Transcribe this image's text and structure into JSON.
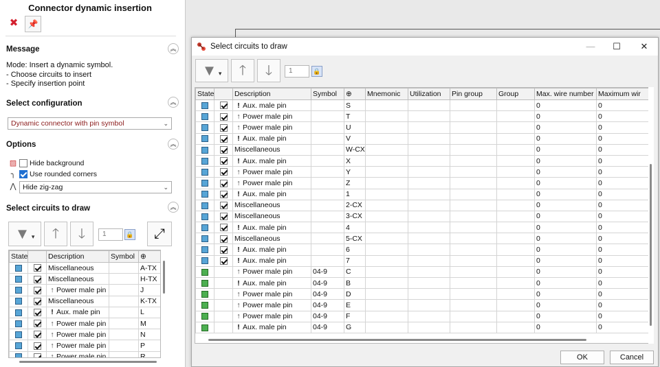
{
  "left_panel": {
    "title": "Connector dynamic insertion",
    "message": {
      "heading": "Message",
      "lines": [
        "Mode: Insert a dynamic symbol.",
        "- Choose circuits to insert",
        "- Specify insertion point"
      ]
    },
    "configuration": {
      "heading": "Select configuration",
      "value": "Dynamic connector with pin symbol"
    },
    "options": {
      "heading": "Options",
      "hide_background": "Hide background",
      "hide_background_checked": false,
      "rounded_corners": "Use rounded corners",
      "rounded_corners_checked": true,
      "zigzag_value": "Hide zig-zag"
    },
    "circuits": {
      "heading": "Select circuits to draw",
      "spin_value": "1",
      "columns": [
        "State",
        "Description",
        "Symbol",
        "⊕"
      ],
      "rows": [
        {
          "desc": "Miscellaneous",
          "pin": "",
          "mnem": "A-TX"
        },
        {
          "desc": "Miscellaneous",
          "pin": "",
          "mnem": "H-TX"
        },
        {
          "desc": "Power male pin",
          "pin": "arrow",
          "mnem": "J"
        },
        {
          "desc": "Miscellaneous",
          "pin": "",
          "mnem": "K-TX"
        },
        {
          "desc": "Aux. male pin",
          "pin": "excl",
          "mnem": "L"
        },
        {
          "desc": "Power male pin",
          "pin": "arrow",
          "mnem": "M"
        },
        {
          "desc": "Power male pin",
          "pin": "arrow",
          "mnem": "N"
        },
        {
          "desc": "Power male pin",
          "pin": "arrow",
          "mnem": "P"
        },
        {
          "desc": "Power male pin",
          "pin": "arrow",
          "mnem": "R"
        }
      ]
    }
  },
  "dialog": {
    "title": "Select circuits to draw",
    "spin_value": "1",
    "columns": [
      "State",
      "",
      "Description",
      "Symbol",
      "⊕",
      "Mnemonic",
      "Utilization",
      "Pin group",
      "Group",
      "Max. wire number",
      "Maximum wir"
    ],
    "rows": [
      {
        "state": "blue",
        "checked": true,
        "pin": "excl",
        "desc": "Aux. male pin",
        "symbol": "",
        "mnem": "S",
        "max_wire": "0",
        "maximum": "0"
      },
      {
        "state": "blue",
        "checked": true,
        "pin": "arrow",
        "desc": "Power male pin",
        "symbol": "",
        "mnem": "T",
        "max_wire": "0",
        "maximum": "0"
      },
      {
        "state": "blue",
        "checked": true,
        "pin": "arrow",
        "desc": "Power male pin",
        "symbol": "",
        "mnem": "U",
        "max_wire": "0",
        "maximum": "0"
      },
      {
        "state": "blue",
        "checked": true,
        "pin": "excl",
        "desc": "Aux. male pin",
        "symbol": "",
        "mnem": "V",
        "max_wire": "0",
        "maximum": "0"
      },
      {
        "state": "blue",
        "checked": true,
        "pin": "",
        "desc": "Miscellaneous",
        "symbol": "",
        "mnem": "W-CX",
        "max_wire": "0",
        "maximum": "0"
      },
      {
        "state": "blue",
        "checked": true,
        "pin": "excl",
        "desc": "Aux. male pin",
        "symbol": "",
        "mnem": "X",
        "max_wire": "0",
        "maximum": "0"
      },
      {
        "state": "blue",
        "checked": true,
        "pin": "arrow",
        "desc": "Power male pin",
        "symbol": "",
        "mnem": "Y",
        "max_wire": "0",
        "maximum": "0"
      },
      {
        "state": "blue",
        "checked": true,
        "pin": "arrow",
        "desc": "Power male pin",
        "symbol": "",
        "mnem": "Z",
        "max_wire": "0",
        "maximum": "0"
      },
      {
        "state": "blue",
        "checked": true,
        "pin": "excl",
        "desc": "Aux. male pin",
        "symbol": "",
        "mnem": "1",
        "max_wire": "0",
        "maximum": "0"
      },
      {
        "state": "blue",
        "checked": true,
        "pin": "",
        "desc": "Miscellaneous",
        "symbol": "",
        "mnem": "2-CX",
        "max_wire": "0",
        "maximum": "0"
      },
      {
        "state": "blue",
        "checked": true,
        "pin": "",
        "desc": "Miscellaneous",
        "symbol": "",
        "mnem": "3-CX",
        "max_wire": "0",
        "maximum": "0"
      },
      {
        "state": "blue",
        "checked": true,
        "pin": "excl",
        "desc": "Aux. male pin",
        "symbol": "",
        "mnem": "4",
        "max_wire": "0",
        "maximum": "0"
      },
      {
        "state": "blue",
        "checked": true,
        "pin": "",
        "desc": "Miscellaneous",
        "symbol": "",
        "mnem": "5-CX",
        "max_wire": "0",
        "maximum": "0"
      },
      {
        "state": "blue",
        "checked": true,
        "pin": "excl",
        "desc": "Aux. male pin",
        "symbol": "",
        "mnem": "6",
        "max_wire": "0",
        "maximum": "0"
      },
      {
        "state": "blue",
        "checked": true,
        "pin": "excl",
        "desc": "Aux. male pin",
        "symbol": "",
        "mnem": "7",
        "max_wire": "0",
        "maximum": "0"
      },
      {
        "state": "green",
        "checked": false,
        "pin": "arrow",
        "desc": "Power male pin",
        "symbol": "04-9",
        "mnem": "C",
        "max_wire": "0",
        "maximum": "0"
      },
      {
        "state": "green",
        "checked": false,
        "pin": "excl",
        "desc": "Aux. male pin",
        "symbol": "04-9",
        "mnem": "B",
        "max_wire": "0",
        "maximum": "0"
      },
      {
        "state": "green",
        "checked": false,
        "pin": "arrow",
        "desc": "Power male pin",
        "symbol": "04-9",
        "mnem": "D",
        "max_wire": "0",
        "maximum": "0"
      },
      {
        "state": "green",
        "checked": false,
        "pin": "arrow",
        "desc": "Power male pin",
        "symbol": "04-9",
        "mnem": "E",
        "max_wire": "0",
        "maximum": "0"
      },
      {
        "state": "green",
        "checked": false,
        "pin": "arrow",
        "desc": "Power male pin",
        "symbol": "04-9",
        "mnem": "F",
        "max_wire": "0",
        "maximum": "0"
      },
      {
        "state": "green",
        "checked": false,
        "pin": "excl",
        "desc": "Aux. male pin",
        "symbol": "04-9",
        "mnem": "G",
        "max_wire": "0",
        "maximum": "0"
      }
    ],
    "ok_label": "OK",
    "cancel_label": "Cancel"
  }
}
